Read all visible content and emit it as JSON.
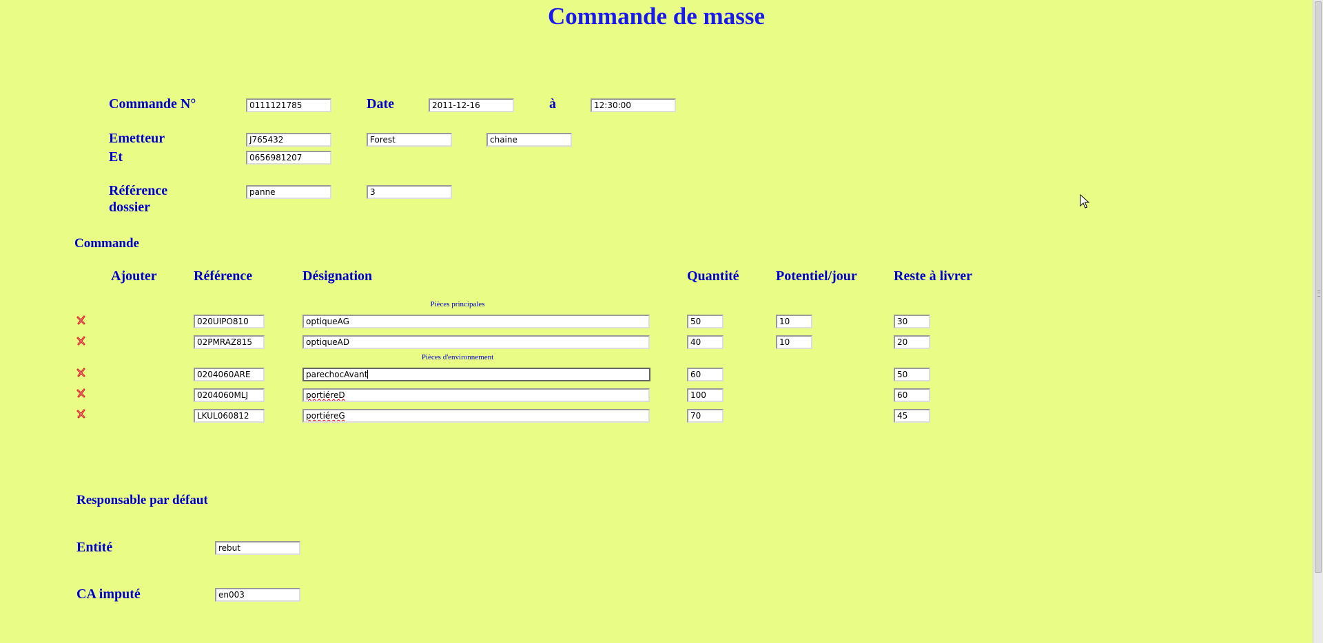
{
  "page": {
    "title": "Commande de masse"
  },
  "header": {
    "commande_no_label": "Commande N°",
    "commande_no_value": "0111121785",
    "date_label": "Date",
    "date_value": "2011-12-16",
    "time_label": "à",
    "time_value": "12:30:00",
    "emetteur_label": "Emetteur",
    "emetteur_code": "J765432",
    "emetteur_name": "Forest",
    "emetteur_type": "chaine",
    "et_label": "Et",
    "et_value": "0656981207",
    "reference_label_line1": "Référence",
    "reference_label_line2": "dossier",
    "reference_value": "panne",
    "reference_number": "3"
  },
  "order": {
    "section_label": "Commande",
    "columns": {
      "add": "Ajouter",
      "reference": "Référence",
      "designation": "Désignation",
      "quantity": "Quantité",
      "potential": "Potentiel/jour",
      "remaining": "Reste à livrer"
    },
    "group_main_label": "Pièces principales",
    "group_env_label": "Pièces d'environnement",
    "main_rows": [
      {
        "reference": "020UIPO810",
        "designation": "optiqueAG",
        "quantity": "50",
        "potential": "10",
        "remaining": "30"
      },
      {
        "reference": "02PMRAZ815",
        "designation": "optiqueAD",
        "quantity": "40",
        "potential": "10",
        "remaining": "20"
      }
    ],
    "env_rows": [
      {
        "reference": "0204060ARE",
        "designation": "parechocAvant",
        "quantity": "60",
        "remaining": "50"
      },
      {
        "reference": "0204060MLJ",
        "designation": "portiéreD",
        "quantity": "100",
        "remaining": "60"
      },
      {
        "reference": "LKUL060812",
        "designation": "portiéreG",
        "quantity": "70",
        "remaining": "45"
      }
    ]
  },
  "defaults": {
    "responsable_label": "Responsable par défaut",
    "entite_label": "Entité",
    "entite_value": "rebut",
    "ca_label": "CA imputé",
    "ca_value": "en003"
  },
  "icons": {
    "delete": "delete-x-icon"
  },
  "colors": {
    "background": "#e9fd86",
    "label": "#0000cc",
    "title": "#1a1aee",
    "delete_icon": "#d42020"
  }
}
